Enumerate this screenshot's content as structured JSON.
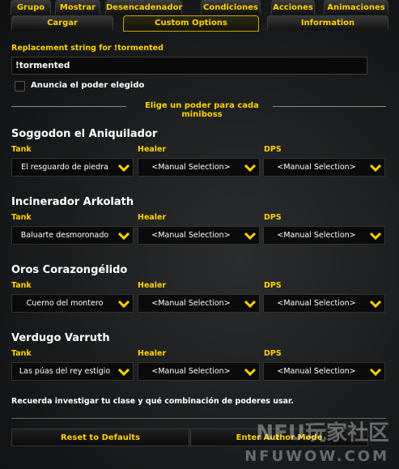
{
  "tabs_row1": [
    {
      "label": "Grupo"
    },
    {
      "label": "Mostrar"
    },
    {
      "label": "Desencadenador"
    },
    {
      "label": "Condiciones"
    },
    {
      "label": "Acciones"
    },
    {
      "label": "Animaciones"
    }
  ],
  "tabs_row2": [
    {
      "label": "Cargar"
    },
    {
      "label": "Custom Options"
    },
    {
      "label": "Information"
    }
  ],
  "replacement": {
    "label": "Replacement string for !tormented",
    "value": "!tormented"
  },
  "announce_checkbox": {
    "label": "Anuncia el poder elegido",
    "checked": false
  },
  "section_header": "Elige un poder para cada miniboss",
  "roles": {
    "tank": "Tank",
    "healer": "Healer",
    "dps": "DPS"
  },
  "bosses": [
    {
      "name": "Soggodon el Aniquilador",
      "tank": "El resguardo de piedra",
      "healer": "<Manual Selection>",
      "dps": "<Manual Selection>"
    },
    {
      "name": "Incinerador Arkolath",
      "tank": "Baluarte desmoronado",
      "healer": "<Manual Selection>",
      "dps": "<Manual Selection>"
    },
    {
      "name": "Oros Corazongélido",
      "tank": "Cuerno del montero",
      "healer": "<Manual Selection>",
      "dps": "<Manual Selection>"
    },
    {
      "name": "Verdugo Varruth",
      "tank": "Las púas del rey estigio",
      "healer": "<Manual Selection>",
      "dps": "<Manual Selection>"
    }
  ],
  "footer_note": "Recuerda investigar tu clase y qué combinación de poderes usar.",
  "buttons": {
    "reset": "Reset to Defaults",
    "author": "Enter Author Mode"
  },
  "watermark": {
    "logo": "NFU玩家社区",
    "site": "NFUWOW.COM"
  },
  "colors": {
    "accent": "#ffd100",
    "text": "#ffffff"
  }
}
